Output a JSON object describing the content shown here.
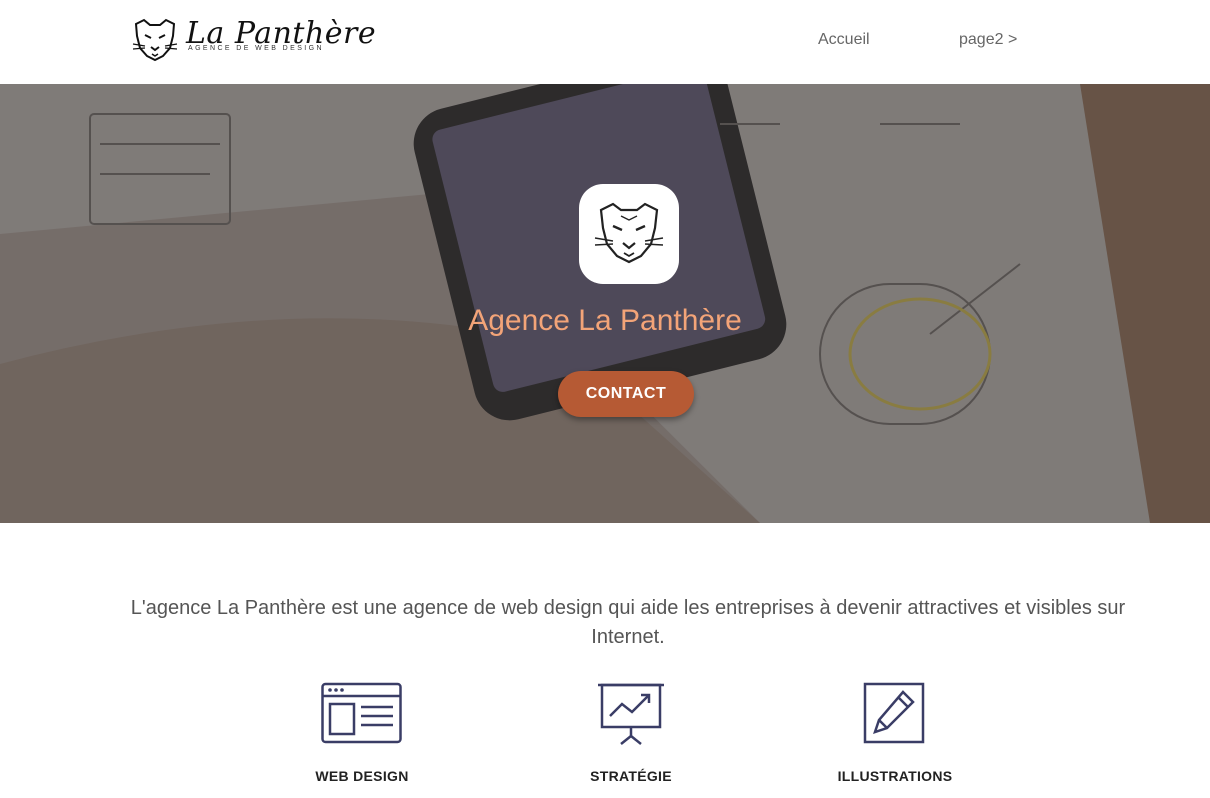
{
  "header": {
    "brand_title": "La Panthère",
    "brand_subtitle": "AGENCE DE WEB DESIGN",
    "nav_home": "Accueil",
    "nav_page2": "page2 >"
  },
  "hero": {
    "title": "Agence La Panthère",
    "cta_label": "CONTACT"
  },
  "intro": {
    "text": "L'agence La Panthère est une agence de web design qui aide les entreprises à devenir attractives et visibles sur Internet."
  },
  "features": [
    {
      "label": "WEB DESIGN",
      "icon": "web-layout-icon"
    },
    {
      "label": "STRATÉGIE",
      "icon": "presentation-chart-icon"
    },
    {
      "label": "ILLUSTRATIONS",
      "icon": "pencil-icon"
    }
  ],
  "colors": {
    "accent_title": "#f3a478",
    "cta": "#b65a34",
    "icon_stroke": "#3a3d66"
  }
}
